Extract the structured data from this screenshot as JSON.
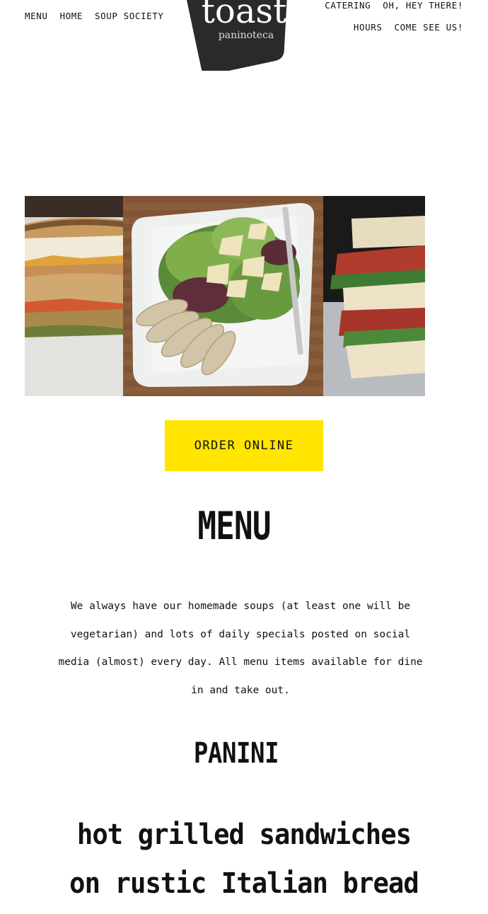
{
  "nav": {
    "left": [
      {
        "label": "MENU"
      },
      {
        "label": "HOME"
      },
      {
        "label": "SOUP SOCIETY"
      }
    ],
    "right_row1": [
      {
        "label": "CATERING"
      },
      {
        "label": "OH, HEY THERE!"
      }
    ],
    "right_row2": [
      {
        "label": "HOURS"
      },
      {
        "label": "COME SEE US!"
      }
    ]
  },
  "logo": {
    "name": "toast",
    "tagline": "paninoteca"
  },
  "gallery": {
    "images": [
      {
        "alt": "grilled panini sandwich"
      },
      {
        "alt": "salad with sliced chicken and shaved parmesan"
      },
      {
        "alt": "BLT sandwich"
      }
    ]
  },
  "cta": {
    "order_label": "ORDER ONLINE"
  },
  "main": {
    "title": "MENU",
    "intro": "We always have our homemade soups (at least one will be vegetarian) and lots of daily specials posted on social media (almost) every day. All menu items available for dine in and take out.",
    "section_title": "PANINI",
    "section_subtitle_line1": "hot grilled sandwiches",
    "section_subtitle_line2": "on rustic Italian bread"
  },
  "colors": {
    "accent": "#ffe500",
    "logo_bg": "#2a2a2a",
    "text": "#111111"
  }
}
